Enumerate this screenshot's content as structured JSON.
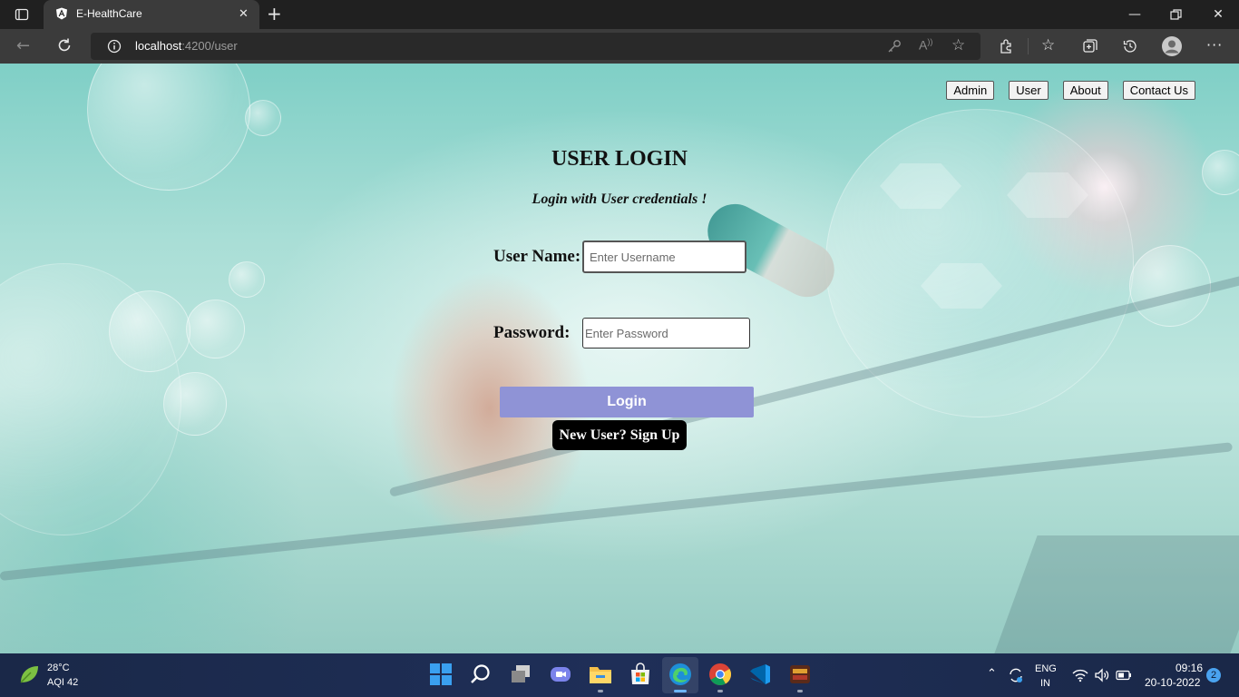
{
  "browser": {
    "tab_title": "E-HealthCare",
    "url_host": "localhost",
    "url_path": ":4200/user"
  },
  "nav": {
    "admin": "Admin",
    "user": "User",
    "about": "About",
    "contact": "Contact Us"
  },
  "login": {
    "title": "USER LOGIN",
    "subtitle": "Login with User credentials !",
    "username_label": "User Name:",
    "username_placeholder": "Enter Username",
    "password_label": "Password:",
    "password_placeholder": "Enter Password",
    "login_button": "Login",
    "signup_button": "New User? Sign Up"
  },
  "colors": {
    "login_button": "#8f93d6",
    "signup_button": "#000000"
  },
  "taskbar": {
    "weather_temp": "28°C",
    "weather_aqi": "AQI 42",
    "lang_1": "ENG",
    "lang_2": "IN",
    "time": "09:16",
    "date": "20-10-2022",
    "notification_count": "2",
    "apps": [
      "start-icon",
      "search-icon",
      "task-view-icon",
      "teams-chat-icon",
      "file-explorer-icon",
      "store-icon",
      "edge-icon",
      "chrome-icon",
      "vscode-icon",
      "game-app-icon"
    ]
  }
}
